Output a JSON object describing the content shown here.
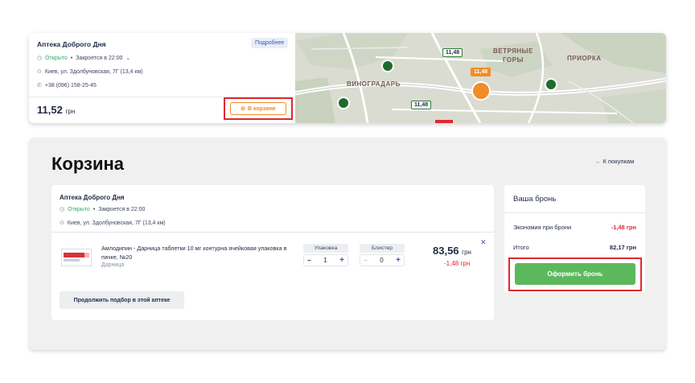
{
  "pharmacy_card": {
    "name": "Аптека Доброго Дня",
    "more_label": "Подробнее",
    "status_open": "Открыто",
    "status_closes": "Закроется в 22:00",
    "address": "Киев, ул. Здолбуновская, 7Г (13,4 км)",
    "phone": "+38 (096) 158-25-45",
    "price": "11,52",
    "currency": "грн",
    "in_cart_label": "В корзине"
  },
  "map": {
    "labels": {
      "district1": "ВИНОГРАДАРЬ",
      "district2_line1": "ВЕТРЯНЫЕ",
      "district2_line2": "ГОРЫ",
      "district3": "ПРИОРКА"
    },
    "price_tags": {
      "tag1": "11,48",
      "tag2": "11,48",
      "tag3": "11,48"
    }
  },
  "cart": {
    "title": "Корзина",
    "back_label": "К покупкам",
    "order": {
      "pharmacy_name": "Аптека Доброго Дня",
      "status_open": "Открыто",
      "status_closes": "Закроется в 22:00",
      "address": "Киев, ул. Здолбуновская, 7Г (13,4 км)",
      "product": {
        "title": "Амлодипин - Дарница таблетки 10 мг контурна ячейковая упаковка в пачке, №20",
        "maker": "Дарница",
        "pack_label": "Упаковка",
        "pack_qty": "1",
        "blister_label": "Блистер",
        "blister_qty": "0",
        "price": "83,56",
        "currency": "грн",
        "discount": "-1,48 грн"
      },
      "continue_label": "Продолжить подбор в этой аптеке"
    },
    "summary": {
      "title": "Ваша бронь",
      "savings_label": "Экономия при брони",
      "savings_value": "-1,48 грн",
      "total_label": "Итого",
      "total_value": "82,17 грн",
      "submit_label": "Оформить бронь"
    }
  }
}
